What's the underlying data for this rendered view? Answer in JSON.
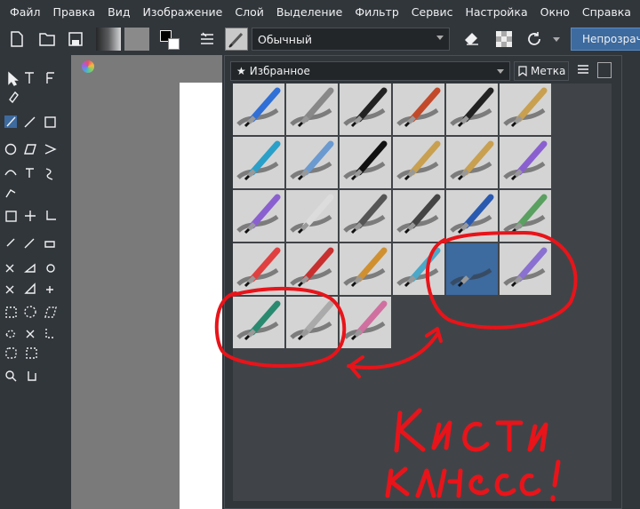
{
  "menu": {
    "items": [
      {
        "label": "Файл"
      },
      {
        "label": "Правка"
      },
      {
        "label": "Вид"
      },
      {
        "label": "Изображение"
      },
      {
        "label": "Слой"
      },
      {
        "label": "Выделение"
      },
      {
        "label": "Фильтр"
      },
      {
        "label": "Сервис"
      },
      {
        "label": "Настройка"
      },
      {
        "label": "Окно"
      },
      {
        "label": "Справка"
      }
    ]
  },
  "toolbar": {
    "blend_mode": "Обычный",
    "opacity_label": "Непрозрачн"
  },
  "preset_popup": {
    "tag_filter": "Избранное",
    "tag_button": "Метка",
    "presets": [
      {
        "icon": "airbrush-blue-brush-icon"
      },
      {
        "icon": "eraser-smudge-icon"
      },
      {
        "icon": "airbrush-soft-icon"
      },
      {
        "icon": "ink-brush-icon"
      },
      {
        "icon": "pencil-icon"
      },
      {
        "icon": "flat-brush-icon"
      },
      {
        "icon": "marker-blue-icon"
      },
      {
        "icon": "blender-dots-icon"
      },
      {
        "icon": "marker-black-icon"
      },
      {
        "icon": "bristle-brush-icon"
      },
      {
        "icon": "dry-brush-icon"
      },
      {
        "icon": "purple-brush-icon"
      },
      {
        "icon": "wet-purple-brush-icon"
      },
      {
        "icon": "smooth-brush-icon"
      },
      {
        "icon": "texture-rock-icon"
      },
      {
        "icon": "texture-stamp-icon"
      },
      {
        "icon": "blue-texture-brush-icon"
      },
      {
        "icon": "experiment-flask-icon"
      },
      {
        "icon": "pixel-brush-icon"
      },
      {
        "icon": "pixel-red-brush-icon"
      },
      {
        "icon": "pixel-gold-brush-icon"
      },
      {
        "icon": "clone-tool-icon"
      },
      {
        "icon": "calligraphy-blue-icon"
      },
      {
        "icon": "multicolor-calligraphy-icon"
      },
      {
        "icon": "feather-pen-icon"
      },
      {
        "icon": "feather-quill-icon"
      },
      {
        "icon": "filter-brushes-icon"
      }
    ]
  },
  "annotation": {
    "line1": "Кисти",
    "line2": "класс !"
  },
  "colors": {
    "annotation_red": "#e8141a",
    "selected_cell": "#3d6a9f"
  }
}
